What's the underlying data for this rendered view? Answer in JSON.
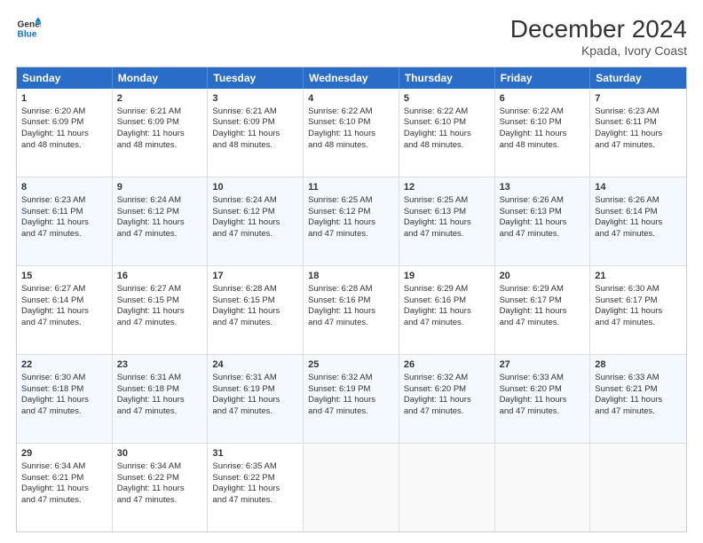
{
  "header": {
    "logo": {
      "line1": "General",
      "line2": "Blue"
    },
    "title": "December 2024",
    "subtitle": "Kpada, Ivory Coast"
  },
  "weekdays": [
    "Sunday",
    "Monday",
    "Tuesday",
    "Wednesday",
    "Thursday",
    "Friday",
    "Saturday"
  ],
  "rows": [
    [
      {
        "day": "1",
        "lines": [
          "Sunrise: 6:20 AM",
          "Sunset: 6:09 PM",
          "Daylight: 11 hours",
          "and 48 minutes."
        ]
      },
      {
        "day": "2",
        "lines": [
          "Sunrise: 6:21 AM",
          "Sunset: 6:09 PM",
          "Daylight: 11 hours",
          "and 48 minutes."
        ]
      },
      {
        "day": "3",
        "lines": [
          "Sunrise: 6:21 AM",
          "Sunset: 6:09 PM",
          "Daylight: 11 hours",
          "and 48 minutes."
        ]
      },
      {
        "day": "4",
        "lines": [
          "Sunrise: 6:22 AM",
          "Sunset: 6:10 PM",
          "Daylight: 11 hours",
          "and 48 minutes."
        ]
      },
      {
        "day": "5",
        "lines": [
          "Sunrise: 6:22 AM",
          "Sunset: 6:10 PM",
          "Daylight: 11 hours",
          "and 48 minutes."
        ]
      },
      {
        "day": "6",
        "lines": [
          "Sunrise: 6:22 AM",
          "Sunset: 6:10 PM",
          "Daylight: 11 hours",
          "and 48 minutes."
        ]
      },
      {
        "day": "7",
        "lines": [
          "Sunrise: 6:23 AM",
          "Sunset: 6:11 PM",
          "Daylight: 11 hours",
          "and 47 minutes."
        ]
      }
    ],
    [
      {
        "day": "8",
        "lines": [
          "Sunrise: 6:23 AM",
          "Sunset: 6:11 PM",
          "Daylight: 11 hours",
          "and 47 minutes."
        ]
      },
      {
        "day": "9",
        "lines": [
          "Sunrise: 6:24 AM",
          "Sunset: 6:12 PM",
          "Daylight: 11 hours",
          "and 47 minutes."
        ]
      },
      {
        "day": "10",
        "lines": [
          "Sunrise: 6:24 AM",
          "Sunset: 6:12 PM",
          "Daylight: 11 hours",
          "and 47 minutes."
        ]
      },
      {
        "day": "11",
        "lines": [
          "Sunrise: 6:25 AM",
          "Sunset: 6:12 PM",
          "Daylight: 11 hours",
          "and 47 minutes."
        ]
      },
      {
        "day": "12",
        "lines": [
          "Sunrise: 6:25 AM",
          "Sunset: 6:13 PM",
          "Daylight: 11 hours",
          "and 47 minutes."
        ]
      },
      {
        "day": "13",
        "lines": [
          "Sunrise: 6:26 AM",
          "Sunset: 6:13 PM",
          "Daylight: 11 hours",
          "and 47 minutes."
        ]
      },
      {
        "day": "14",
        "lines": [
          "Sunrise: 6:26 AM",
          "Sunset: 6:14 PM",
          "Daylight: 11 hours",
          "and 47 minutes."
        ]
      }
    ],
    [
      {
        "day": "15",
        "lines": [
          "Sunrise: 6:27 AM",
          "Sunset: 6:14 PM",
          "Daylight: 11 hours",
          "and 47 minutes."
        ]
      },
      {
        "day": "16",
        "lines": [
          "Sunrise: 6:27 AM",
          "Sunset: 6:15 PM",
          "Daylight: 11 hours",
          "and 47 minutes."
        ]
      },
      {
        "day": "17",
        "lines": [
          "Sunrise: 6:28 AM",
          "Sunset: 6:15 PM",
          "Daylight: 11 hours",
          "and 47 minutes."
        ]
      },
      {
        "day": "18",
        "lines": [
          "Sunrise: 6:28 AM",
          "Sunset: 6:16 PM",
          "Daylight: 11 hours",
          "and 47 minutes."
        ]
      },
      {
        "day": "19",
        "lines": [
          "Sunrise: 6:29 AM",
          "Sunset: 6:16 PM",
          "Daylight: 11 hours",
          "and 47 minutes."
        ]
      },
      {
        "day": "20",
        "lines": [
          "Sunrise: 6:29 AM",
          "Sunset: 6:17 PM",
          "Daylight: 11 hours",
          "and 47 minutes."
        ]
      },
      {
        "day": "21",
        "lines": [
          "Sunrise: 6:30 AM",
          "Sunset: 6:17 PM",
          "Daylight: 11 hours",
          "and 47 minutes."
        ]
      }
    ],
    [
      {
        "day": "22",
        "lines": [
          "Sunrise: 6:30 AM",
          "Sunset: 6:18 PM",
          "Daylight: 11 hours",
          "and 47 minutes."
        ]
      },
      {
        "day": "23",
        "lines": [
          "Sunrise: 6:31 AM",
          "Sunset: 6:18 PM",
          "Daylight: 11 hours",
          "and 47 minutes."
        ]
      },
      {
        "day": "24",
        "lines": [
          "Sunrise: 6:31 AM",
          "Sunset: 6:19 PM",
          "Daylight: 11 hours",
          "and 47 minutes."
        ]
      },
      {
        "day": "25",
        "lines": [
          "Sunrise: 6:32 AM",
          "Sunset: 6:19 PM",
          "Daylight: 11 hours",
          "and 47 minutes."
        ]
      },
      {
        "day": "26",
        "lines": [
          "Sunrise: 6:32 AM",
          "Sunset: 6:20 PM",
          "Daylight: 11 hours",
          "and 47 minutes."
        ]
      },
      {
        "day": "27",
        "lines": [
          "Sunrise: 6:33 AM",
          "Sunset: 6:20 PM",
          "Daylight: 11 hours",
          "and 47 minutes."
        ]
      },
      {
        "day": "28",
        "lines": [
          "Sunrise: 6:33 AM",
          "Sunset: 6:21 PM",
          "Daylight: 11 hours",
          "and 47 minutes."
        ]
      }
    ],
    [
      {
        "day": "29",
        "lines": [
          "Sunrise: 6:34 AM",
          "Sunset: 6:21 PM",
          "Daylight: 11 hours",
          "and 47 minutes."
        ]
      },
      {
        "day": "30",
        "lines": [
          "Sunrise: 6:34 AM",
          "Sunset: 6:22 PM",
          "Daylight: 11 hours",
          "and 47 minutes."
        ]
      },
      {
        "day": "31",
        "lines": [
          "Sunrise: 6:35 AM",
          "Sunset: 6:22 PM",
          "Daylight: 11 hours",
          "and 47 minutes."
        ]
      },
      {
        "day": "",
        "lines": []
      },
      {
        "day": "",
        "lines": []
      },
      {
        "day": "",
        "lines": []
      },
      {
        "day": "",
        "lines": []
      }
    ]
  ]
}
